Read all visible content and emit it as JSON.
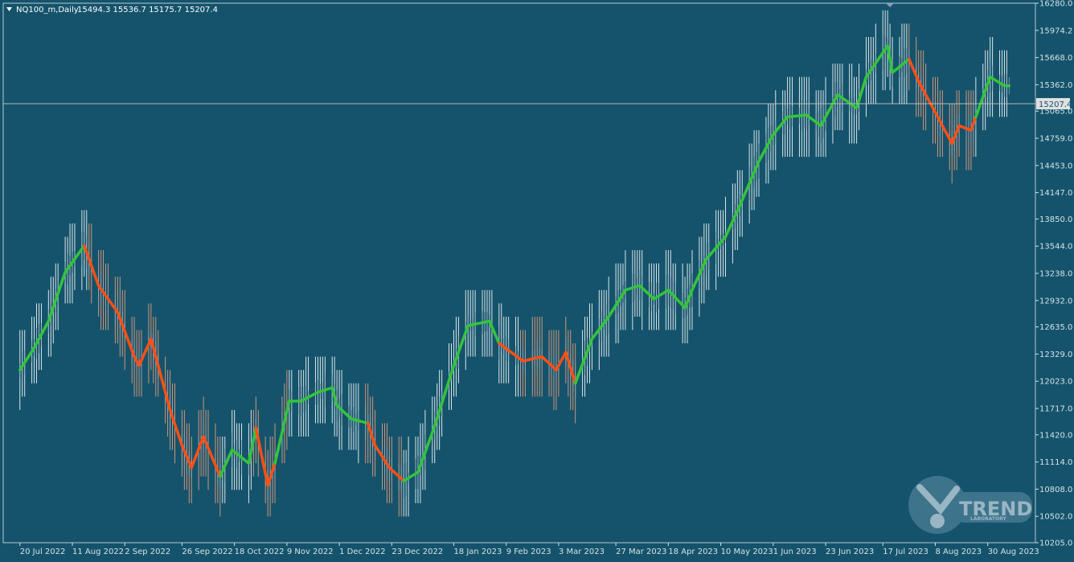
{
  "header": {
    "symbol": "NQ100_m,Daily",
    "ohlc": "15494.3 15536.7 15175.7 15207.4",
    "dropdown_icon": "triangle-down-icon"
  },
  "price_marker": {
    "label": "15207.4",
    "value": 15207.4
  },
  "logo": {
    "brand": "TREND",
    "sub": "LABORATORY"
  },
  "colors": {
    "background": "#14536b",
    "up_trend": "#33c43c",
    "down_trend": "#ff4f14",
    "up_band": "#ffffff",
    "down_band": "#f0a27f",
    "candle": "#8aa6b4",
    "axis": "#d6e2e8"
  },
  "chart_data": {
    "type": "candlestick",
    "title": "",
    "xlabel": "",
    "ylabel": "",
    "ylim": [
      10205.0,
      16280.0
    ],
    "grid": false,
    "y_ticks": [
      "16280.0",
      "15974.2",
      "15668.0",
      "15362.0",
      "15065.0",
      "14759.0",
      "14453.0",
      "14147.0",
      "13850.0",
      "13544.0",
      "13238.0",
      "12932.0",
      "12635.0",
      "12329.0",
      "12023.0",
      "11717.0",
      "11420.0",
      "11114.0",
      "10808.0",
      "10502.0",
      "10205.0"
    ],
    "x_ticks": [
      "20 Jul 2022",
      "11 Aug 2022",
      "2 Sep 2022",
      "26 Sep 2022",
      "18 Oct 2022",
      "9 Nov 2022",
      "1 Dec 2022",
      "23 Dec 2022",
      "18 Jan 2023",
      "9 Feb 2023",
      "3 Mar 2023",
      "27 Mar 2023",
      "18 Apr 2023",
      "10 May 2023",
      "1 Jun 2023",
      "23 Jun 2023",
      "17 Jul 2023",
      "8 Aug 2023",
      "30 Aug 2023"
    ],
    "price_path": {
      "dates": [
        "2022-07-20",
        "2022-07-26",
        "2022-08-01",
        "2022-08-08",
        "2022-08-16",
        "2022-08-22",
        "2022-08-30",
        "2022-09-06",
        "2022-09-08",
        "2022-09-13",
        "2022-09-21",
        "2022-09-26",
        "2022-09-30",
        "2022-10-05",
        "2022-10-12",
        "2022-10-17",
        "2022-10-24",
        "2022-10-27",
        "2022-11-01",
        "2022-11-04",
        "2022-11-10",
        "2022-11-15",
        "2022-11-22",
        "2022-11-28",
        "2022-11-30",
        "2022-12-06",
        "2022-12-13",
        "2022-12-16",
        "2022-12-22",
        "2022-12-28",
        "2023-01-03",
        "2023-01-10",
        "2023-01-18",
        "2023-01-24",
        "2023-02-02",
        "2023-02-06",
        "2023-02-16",
        "2023-02-24",
        "2023-03-02",
        "2023-03-06",
        "2023-03-10",
        "2023-03-17",
        "2023-03-24",
        "2023-03-31",
        "2023-04-06",
        "2023-04-12",
        "2023-04-18",
        "2023-04-25",
        "2023-04-28",
        "2023-05-04",
        "2023-05-12",
        "2023-05-18",
        "2023-05-26",
        "2023-06-01",
        "2023-06-07",
        "2023-06-15",
        "2023-06-21",
        "2023-06-28",
        "2023-07-06",
        "2023-07-10",
        "2023-07-19",
        "2023-07-21",
        "2023-07-28",
        "2023-08-01",
        "2023-08-04",
        "2023-08-10",
        "2023-08-15",
        "2023-08-18",
        "2023-08-23",
        "2023-08-25",
        "2023-08-31",
        "2023-09-06",
        "2023-09-08"
      ],
      "values": [
        12150,
        12400,
        12700,
        13250,
        13550,
        13100,
        12800,
        12300,
        12200,
        12500,
        11700,
        11300,
        11050,
        11400,
        10950,
        11250,
        11100,
        11500,
        10850,
        11100,
        11800,
        11800,
        11900,
        11950,
        11750,
        11600,
        11550,
        11300,
        11050,
        10900,
        11000,
        11520,
        12200,
        12650,
        12700,
        12450,
        12250,
        12300,
        12150,
        12350,
        12000,
        12500,
        12750,
        13050,
        13100,
        12950,
        13050,
        12850,
        13050,
        13400,
        13650,
        14000,
        14500,
        14800,
        15000,
        15020,
        14900,
        15250,
        15100,
        15450,
        15800,
        15500,
        15650,
        15400,
        15250,
        14950,
        14700,
        14900,
        14850,
        15000,
        15450,
        15350,
        15350
      ],
      "trend": [
        "up",
        "up",
        "up",
        "up",
        "up",
        "down",
        "down",
        "down",
        "down",
        "down",
        "down",
        "down",
        "down",
        "down",
        "down",
        "up",
        "up",
        "up",
        "down",
        "down",
        "up",
        "up",
        "up",
        "up",
        "up",
        "up",
        "up",
        "down",
        "down",
        "down",
        "up",
        "up",
        "up",
        "up",
        "up",
        "up",
        "down",
        "down",
        "down",
        "down",
        "down",
        "up",
        "up",
        "up",
        "up",
        "up",
        "up",
        "up",
        "up",
        "up",
        "up",
        "up",
        "up",
        "up",
        "up",
        "up",
        "up",
        "up",
        "up",
        "up",
        "up",
        "up",
        "up",
        "down",
        "down",
        "down",
        "down",
        "down",
        "down",
        "down",
        "up",
        "up",
        "up"
      ]
    },
    "band_regimes": [
      {
        "start": "2022-07-20",
        "end": "2022-08-18",
        "trend": "up"
      },
      {
        "start": "2022-08-18",
        "end": "2022-10-13",
        "trend": "down"
      },
      {
        "start": "2022-10-13",
        "end": "2022-10-26",
        "trend": "up"
      },
      {
        "start": "2022-10-26",
        "end": "2022-11-10",
        "trend": "down"
      },
      {
        "start": "2022-11-10",
        "end": "2022-12-12",
        "trend": "up"
      },
      {
        "start": "2022-12-12",
        "end": "2022-12-28",
        "trend": "down"
      },
      {
        "start": "2022-12-28",
        "end": "2023-02-15",
        "trend": "up"
      },
      {
        "start": "2023-02-15",
        "end": "2023-03-13",
        "trend": "down"
      },
      {
        "start": "2023-03-13",
        "end": "2023-07-28",
        "trend": "up"
      },
      {
        "start": "2023-07-28",
        "end": "2023-08-25",
        "trend": "down"
      },
      {
        "start": "2023-08-25",
        "end": "2023-09-08",
        "trend": "up"
      }
    ]
  }
}
